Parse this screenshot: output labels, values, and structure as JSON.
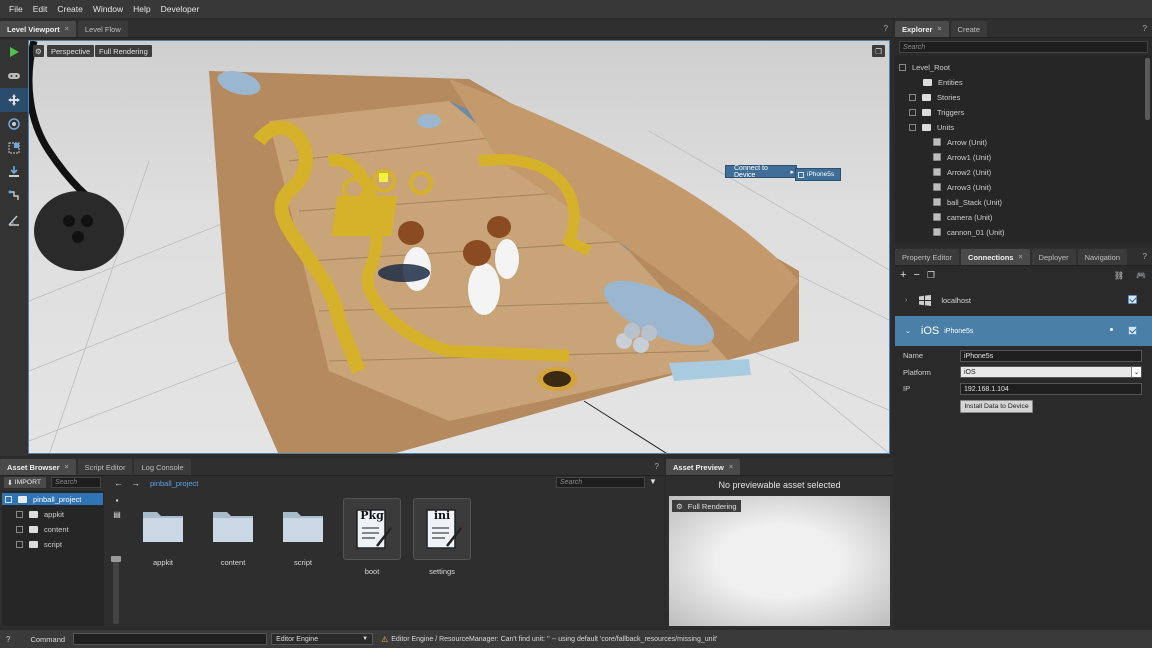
{
  "menu": [
    "File",
    "Edit",
    "Create",
    "Window",
    "Help",
    "Developer"
  ],
  "viewport": {
    "tabs": [
      {
        "label": "Level Viewport",
        "close": "×"
      },
      {
        "label": "Level Flow"
      }
    ],
    "help": "?",
    "camera_mode": "Perspective",
    "render_mode": "Full Rendering",
    "context_menu": {
      "item": "Connect to Device",
      "submenu": "iPhone5s"
    }
  },
  "explorer": {
    "tabs": [
      {
        "label": "Explorer",
        "close": "×"
      },
      {
        "label": "Create"
      }
    ],
    "help": "?",
    "search_placeholder": "Search",
    "tree": [
      {
        "label": "Level_Root"
      },
      {
        "label": "Entities"
      },
      {
        "label": "Stories"
      },
      {
        "label": "Triggers"
      },
      {
        "label": "Units"
      },
      {
        "label": "Arrow (Unit)"
      },
      {
        "label": "Arrow1 (Unit)"
      },
      {
        "label": "Arrow2 (Unit)"
      },
      {
        "label": "Arrow3 (Unit)"
      },
      {
        "label": "ball_Stack (Unit)"
      },
      {
        "label": "camera (Unit)"
      },
      {
        "label": "cannon_01 (Unit)"
      }
    ]
  },
  "properties": {
    "tabs": [
      {
        "label": "Property Editor"
      },
      {
        "label": "Connections",
        "close": "×"
      },
      {
        "label": "Deployer"
      },
      {
        "label": "Navigation"
      }
    ],
    "help": "?",
    "connections": [
      {
        "name": "localhost",
        "platform_badge": "",
        "checked": true
      },
      {
        "name": "iPhone5s",
        "platform_badge": "iOS",
        "checked": true
      }
    ],
    "name_label": "Name",
    "name_value": "iPhone5s",
    "platform_label": "Platform",
    "platform_value": "iOS",
    "ip_label": "IP",
    "ip_value": "192.168.1.104",
    "install_button": "Install Data to Device"
  },
  "assets": {
    "tabs": [
      {
        "label": "Asset Browser",
        "close": "×"
      },
      {
        "label": "Script Editor"
      },
      {
        "label": "Log Console"
      }
    ],
    "help": "?",
    "import_button": "IMPORT",
    "search_placeholder": "Search",
    "path": "pinball_project",
    "path_search_placeholder": "Search",
    "tree": [
      {
        "label": "pinball_project"
      },
      {
        "label": "appkit"
      },
      {
        "label": "content"
      },
      {
        "label": "script"
      }
    ],
    "items": [
      {
        "label": "appkit",
        "kind": "folder"
      },
      {
        "label": "content",
        "kind": "folder"
      },
      {
        "label": "script",
        "kind": "folder"
      },
      {
        "label": "boot",
        "kind": "file",
        "badge": "Pkg"
      },
      {
        "label": "settings",
        "kind": "file",
        "badge": "ini"
      }
    ]
  },
  "preview": {
    "tabs": [
      {
        "label": "Asset Preview",
        "close": "×"
      }
    ],
    "message": "No previewable asset selected",
    "render_mode": "Full Rendering"
  },
  "status": {
    "help": "?",
    "command_label": "Command",
    "engine": "Editor Engine",
    "message": "Editor Engine / ResourceManager: Can't find unit: '' -- using default 'core/fallback_resources/missing_unit'"
  },
  "colors": {
    "accent": "#4a7fa8",
    "selection": "#2f74b5",
    "link": "#5aa6e6",
    "warning": "#e8c43a"
  }
}
